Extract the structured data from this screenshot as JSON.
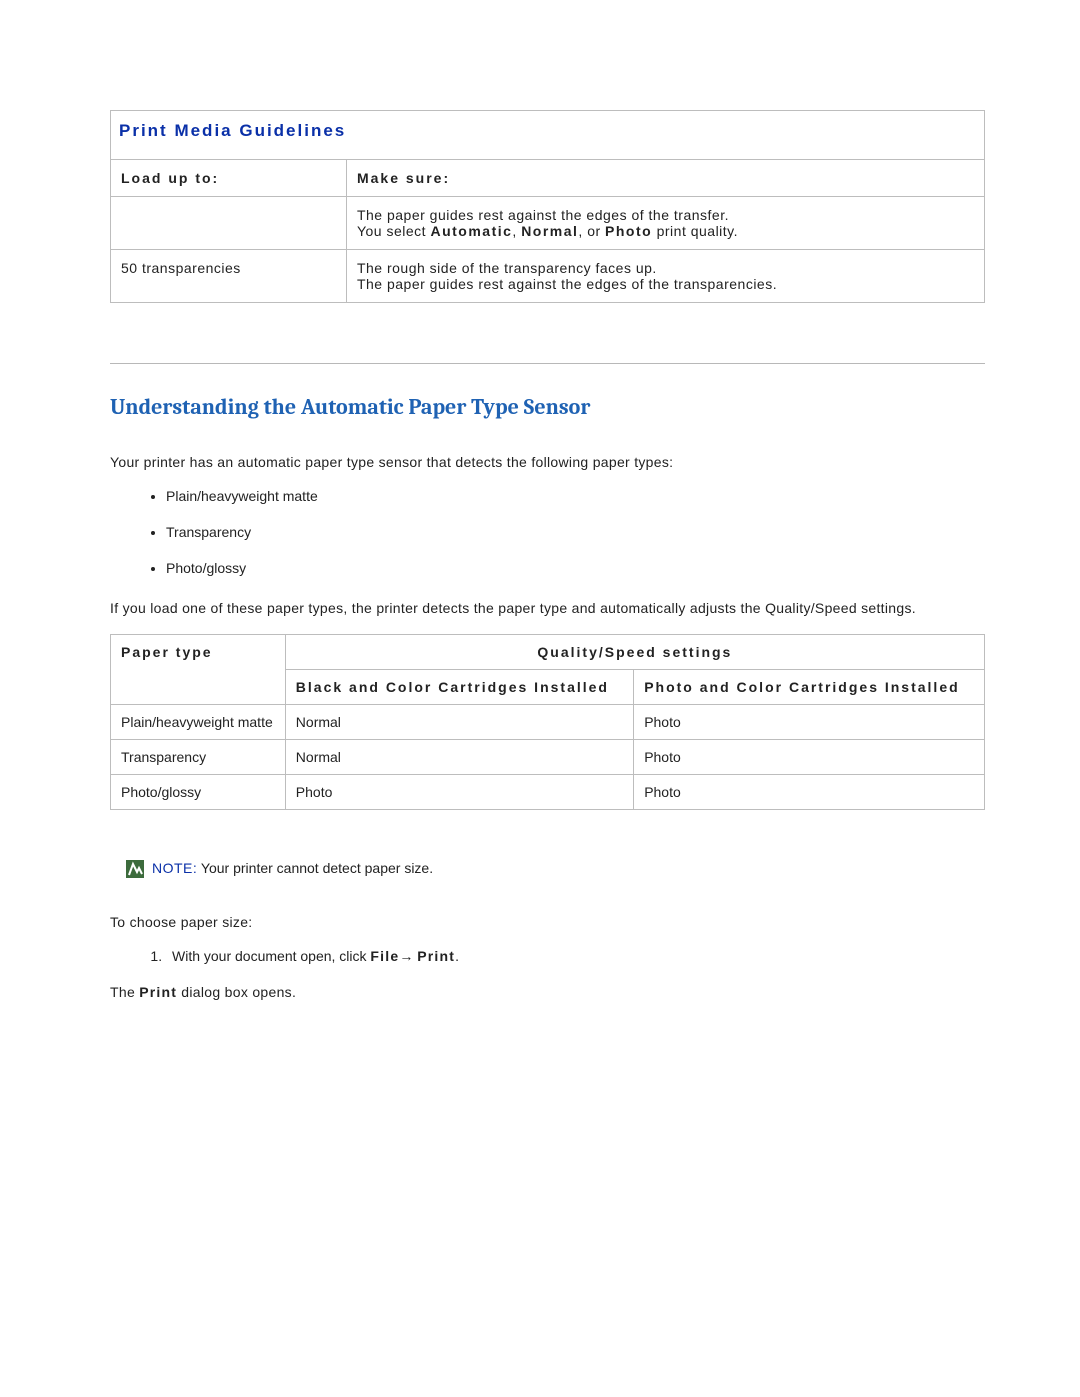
{
  "guidelines": {
    "title": "Print Media Guidelines",
    "col1": "Load up to:",
    "col2": "Make sure:",
    "row1": {
      "left": "",
      "right_line1": "The paper guides rest against the edges of the transfer.",
      "right_line2_a": "You select ",
      "right_line2_b": "Automatic",
      "right_line2_c": ", ",
      "right_line2_d": "Normal",
      "right_line2_e": ", or ",
      "right_line2_f": "Photo",
      "right_line2_g": " print quality."
    },
    "row2": {
      "left": "50 transparencies",
      "right_line1": "The rough side of the transparency faces up.",
      "right_line2": "The paper guides rest against the edges of the transparencies."
    }
  },
  "section": {
    "heading": "Understanding the Automatic Paper Type Sensor",
    "intro": "Your printer has an automatic paper type sensor that detects the following paper types:",
    "bullets": [
      "Plain/heavyweight matte",
      "Transparency",
      "Photo/glossy"
    ],
    "para2": "If you load one of these paper types, the printer detects the paper type and automatically adjusts the Quality/Speed settings."
  },
  "quality_table": {
    "h_paper": "Paper type",
    "h_settings": "Quality/Speed settings",
    "h_black": "Black and Color Cartridges Installed",
    "h_photo": "Photo and Color Cartridges Installed",
    "rows": [
      {
        "paper": "Plain/heavyweight matte",
        "black": "Normal",
        "photo": "Photo"
      },
      {
        "paper": "Transparency",
        "black": "Normal",
        "photo": "Photo"
      },
      {
        "paper": "Photo/glossy",
        "black": "Photo",
        "photo": "Photo"
      }
    ]
  },
  "note": {
    "label": "NOTE:",
    "text": " Your printer cannot detect paper size."
  },
  "choose": {
    "lead": "To choose paper size:",
    "step1_a": "With your document open, click ",
    "step1_b": "File",
    "step1_arrow": "→ ",
    "step1_c": "Print",
    "step1_d": ".",
    "step1_sub_a": "The ",
    "step1_sub_b": "Print",
    "step1_sub_c": " dialog box opens."
  }
}
